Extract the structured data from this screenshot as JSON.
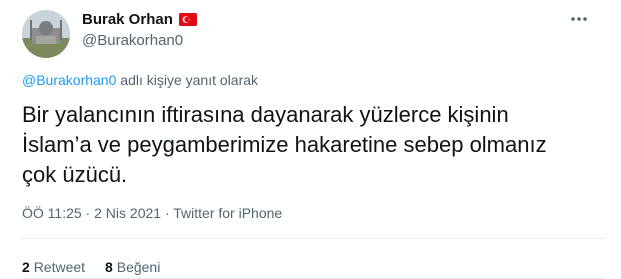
{
  "author": {
    "name": "Burak Orhan",
    "handle": "@Burakorhan0",
    "flag_icon": "turkey-flag-icon"
  },
  "reply": {
    "mention": "@Burakorhan0",
    "suffix": " adlı kişiye yanıt olarak"
  },
  "tweet": {
    "text": "Bir yalancının iftirasına dayanarak yüzlerce kişinin\nİslam’a ve peygamberimize hakaretine sebep olmanız\nçok üzücü."
  },
  "meta": {
    "time": "ÖÖ 11:25",
    "sep1": " · ",
    "date": "2 Nis 2021",
    "sep2": " · ",
    "source": "Twitter for iPhone"
  },
  "stats": {
    "retweets_count": "2",
    "retweets_label": "Retweet",
    "likes_count": "8",
    "likes_label": "Beğeni"
  },
  "colors": {
    "link": "#1d9bf0",
    "muted": "#536471",
    "text": "#0f1419",
    "flag_red": "#e30a17"
  }
}
